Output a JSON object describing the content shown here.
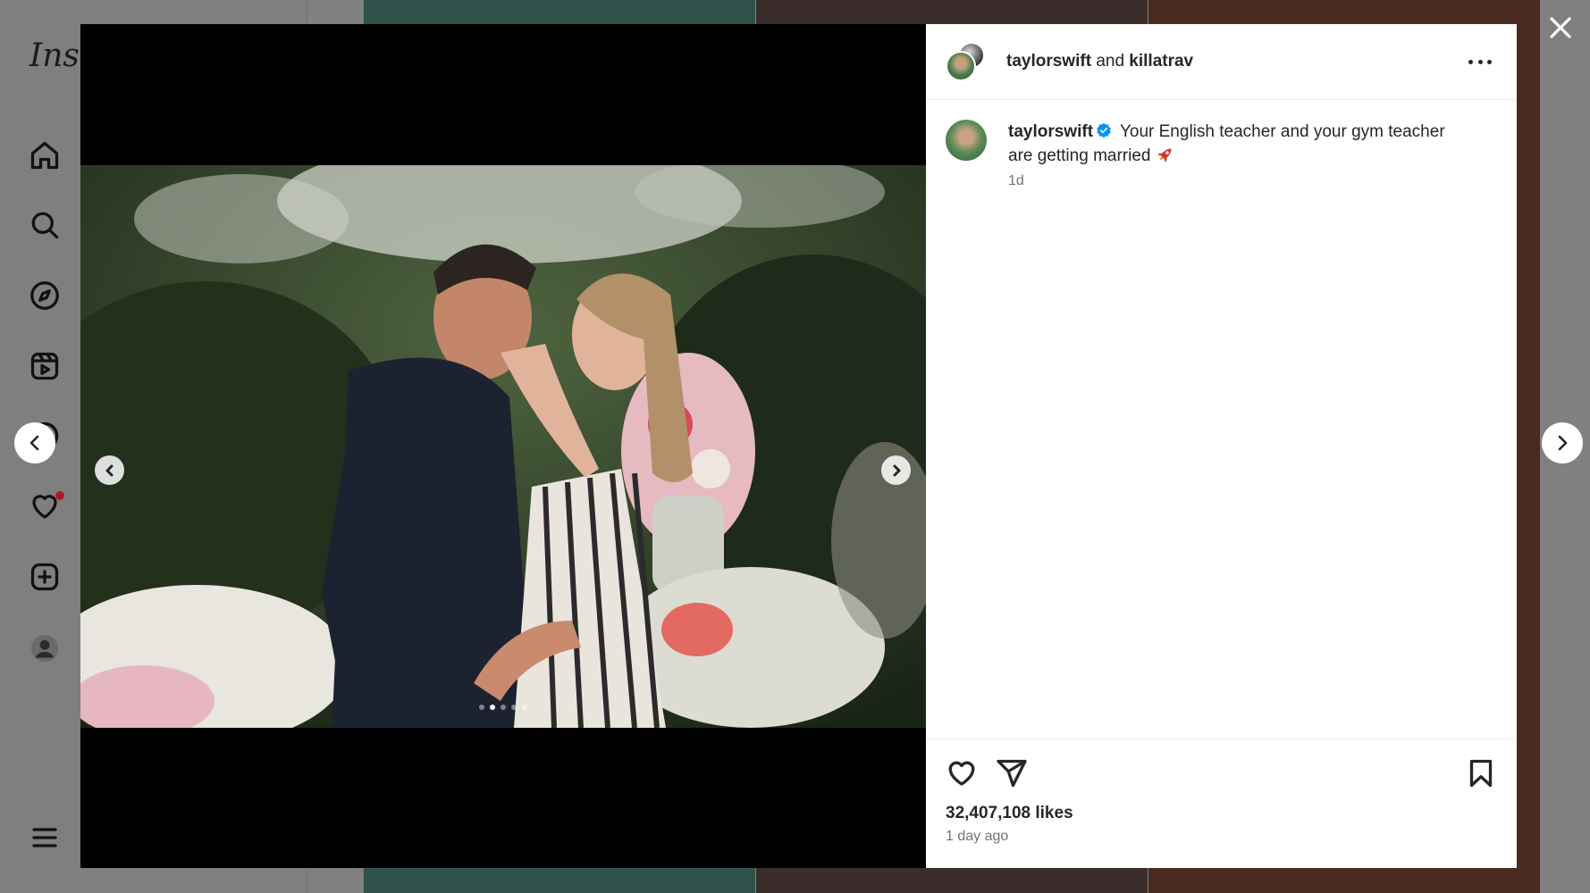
{
  "app": {
    "logo_text": "Inst"
  },
  "sidebar": {
    "items": [
      {
        "icon": "home-icon"
      },
      {
        "icon": "search-icon"
      },
      {
        "icon": "explore-compass-icon"
      },
      {
        "icon": "reels-icon"
      },
      {
        "icon": "messenger-icon"
      },
      {
        "icon": "heart-icon",
        "has_notification": true
      },
      {
        "icon": "create-plus-icon"
      },
      {
        "icon": "profile-avatar-icon"
      },
      {
        "icon": "menu-hamburger-icon"
      }
    ]
  },
  "post": {
    "header": {
      "user1": "taylorswift",
      "connector": "and",
      "user2": "killatrav"
    },
    "caption": {
      "username": "taylorswift",
      "verified": true,
      "text": "Your English teacher and your gym teacher are getting married",
      "emoji": "rocket-emoji",
      "time": "1d"
    },
    "carousel": {
      "total": 5,
      "active_index": 1
    },
    "likes": "32,407,108 likes",
    "posted_ago": "1 day ago"
  },
  "colors": {
    "overlay_bg": "#808080",
    "verified_blue": "#0095f6",
    "notification_red": "#ff3040"
  }
}
